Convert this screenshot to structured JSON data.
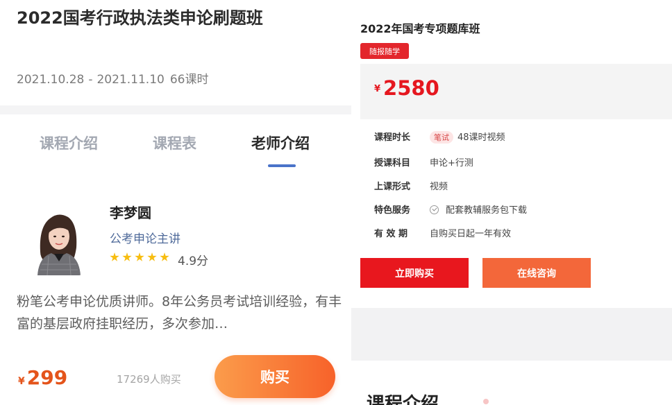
{
  "left": {
    "title": "2022国考行政执法类申论刷题班",
    "meta": {
      "date_start": "2021.10.28",
      "date_sep": "-",
      "date_end": "2021.11.10",
      "lessons": "66课时"
    },
    "tabs": [
      {
        "label": "课程介绍",
        "active": false
      },
      {
        "label": "课程表",
        "active": false
      },
      {
        "label": "老师介绍",
        "active": true
      }
    ],
    "teacher": {
      "name": "李梦圆",
      "role": "公考申论主讲",
      "stars": 5,
      "rating": "4.9分"
    },
    "description": "粉笔公考申论优质讲师。8年公务员考试培训经验，有丰富的基层政府挂职经历，多次参加…",
    "price": {
      "currency": "¥",
      "value": "299"
    },
    "buyers": "17269人购买",
    "buy_label": "购买",
    "colors": {
      "accent": "#f7622a",
      "tab_indicator": "#4a73c9",
      "star": "#f7bd10"
    }
  },
  "right": {
    "title": "2022年国考专项题库班",
    "badge": "随报随学",
    "price": {
      "currency": "¥",
      "value": "2580"
    },
    "info": [
      {
        "key": "课程时长",
        "tag": "笔试",
        "value": "48课时视频"
      },
      {
        "key": "授课科目",
        "value": "申论+行测"
      },
      {
        "key": "上课形式",
        "value": "视频"
      },
      {
        "key": "特色服务",
        "value": "配套教辅服务包下载"
      },
      {
        "key": "有 效 期",
        "value": "自购买日起一年有效"
      }
    ],
    "buy_now_label": "立即购买",
    "consult_label": "在线咨询",
    "section_title": "课程介绍",
    "colors": {
      "primary": "#e8171e",
      "secondary": "#f3673a"
    }
  }
}
